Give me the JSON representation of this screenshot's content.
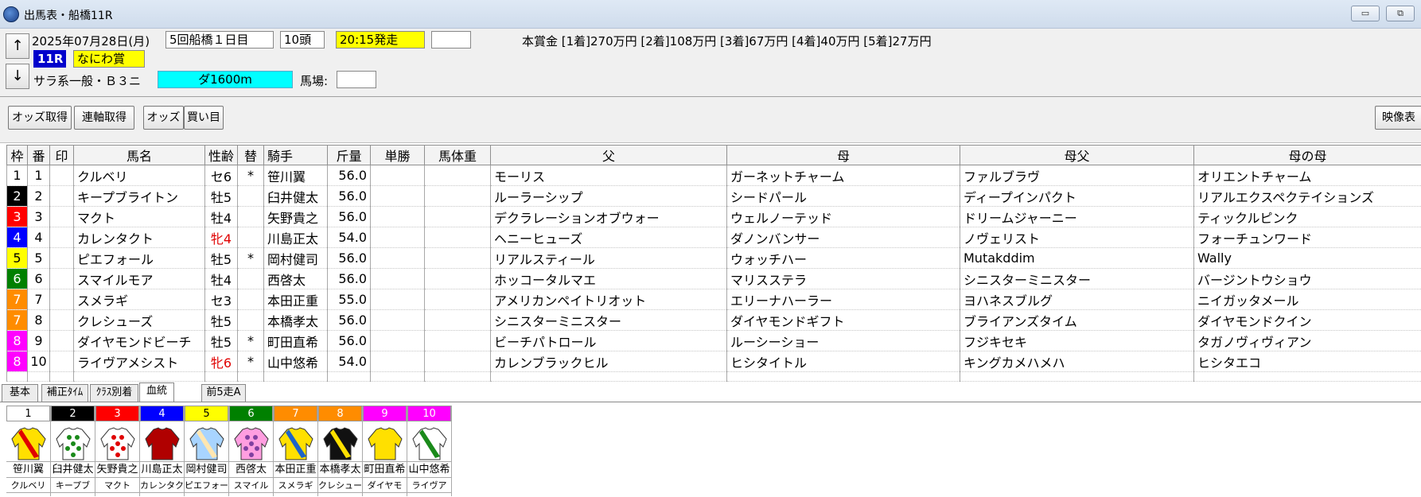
{
  "window": {
    "title": "出馬表・船橋11R",
    "minimize": "▭",
    "restore": "⧉"
  },
  "header": {
    "up_arrow": "↑",
    "down_arrow": "↓",
    "date": "2025年07月28日(月)",
    "meeting": "5回船橋１日目",
    "runners": "10頭",
    "post_time": "20:15発走",
    "blank_box": "",
    "prize": "本賞金 [1着]270万円 [2着]108万円 [3着]67万円 [4着]40万円 [5着]27万円",
    "race_no": "11R",
    "race_name": "なにわ賞",
    "race_class": "サラ系一般・Ｂ３ニ",
    "course": "ダ1600m",
    "going_label": "馬場:",
    "going_value": ""
  },
  "toolbar": {
    "odds": "オッズ取得",
    "renpuku": "連軸取得",
    "odds2": "オッズ",
    "kaime": "買い目",
    "video": "映像表"
  },
  "colors": {
    "waku": [
      "#ffffff",
      "#000000",
      "#ff0000",
      "#0000ff",
      "#ffff00",
      "#008000",
      "#ff8c00",
      "#ff8c00",
      "#ff00ff",
      "#ff00ff"
    ]
  },
  "table": {
    "headers": [
      "枠",
      "番",
      "印",
      "馬名",
      "性齢",
      "替",
      "騎手",
      "斤量",
      "単勝",
      "馬体重",
      "父",
      "母",
      "母父",
      "母の母"
    ],
    "rows": [
      {
        "waku": "1",
        "num": "1",
        "mark": "",
        "name": "クルベリ",
        "sexage": "セ6",
        "change": "*",
        "jockey": "笹川翼",
        "weight": "56.0",
        "win": "",
        "bw": "",
        "sire": "モーリス",
        "dam": "ガーネットチャーム",
        "bms": "ファルブラヴ",
        "damdam": "オリエントチャーム",
        "mare": false
      },
      {
        "waku": "2",
        "num": "2",
        "mark": "",
        "name": "キープブライトン",
        "sexage": "牡5",
        "change": "",
        "jockey": "臼井健太",
        "weight": "56.0",
        "win": "",
        "bw": "",
        "sire": "ルーラーシップ",
        "dam": "シードパール",
        "bms": "ディープインパクト",
        "damdam": "リアルエクスペクテイションズ",
        "mare": false
      },
      {
        "waku": "3",
        "num": "3",
        "mark": "",
        "name": "マクト",
        "sexage": "牡4",
        "change": "",
        "jockey": "矢野貴之",
        "weight": "56.0",
        "win": "",
        "bw": "",
        "sire": "デクラレーションオブウォー",
        "dam": "ウェルノーテッド",
        "bms": "ドリームジャーニー",
        "damdam": "ティックルピンク",
        "mare": false
      },
      {
        "waku": "4",
        "num": "4",
        "mark": "",
        "name": "カレンタクト",
        "sexage": "牝4",
        "change": "",
        "jockey": "川島正太",
        "weight": "54.0",
        "win": "",
        "bw": "",
        "sire": "ヘニーヒューズ",
        "dam": "ダノンバンサー",
        "bms": "ノヴェリスト",
        "damdam": "フォーチュンワード",
        "mare": true
      },
      {
        "waku": "5",
        "num": "5",
        "mark": "",
        "name": "ピエフォール",
        "sexage": "牡5",
        "change": "*",
        "jockey": "岡村健司",
        "weight": "56.0",
        "win": "",
        "bw": "",
        "sire": "リアルスティール",
        "dam": "ウォッチハー",
        "bms": "Mutakddim",
        "damdam": "Wally",
        "mare": false
      },
      {
        "waku": "6",
        "num": "6",
        "mark": "",
        "name": "スマイルモア",
        "sexage": "牡4",
        "change": "",
        "jockey": "西啓太",
        "weight": "56.0",
        "win": "",
        "bw": "",
        "sire": "ホッコータルマエ",
        "dam": "マリスステラ",
        "bms": "シニスターミニスター",
        "damdam": "バージントウショウ",
        "mare": false
      },
      {
        "waku": "7",
        "num": "7",
        "mark": "",
        "name": "スメラギ",
        "sexage": "セ3",
        "change": "",
        "jockey": "本田正重",
        "weight": "55.0",
        "win": "",
        "bw": "",
        "sire": "アメリカンペイトリオット",
        "dam": "エリーナハーラー",
        "bms": "ヨハネスブルグ",
        "damdam": "ニイガッタメール",
        "mare": false
      },
      {
        "waku": "7",
        "num": "8",
        "mark": "",
        "name": "クレシューズ",
        "sexage": "牡5",
        "change": "",
        "jockey": "本橋孝太",
        "weight": "56.0",
        "win": "",
        "bw": "",
        "sire": "シニスターミニスター",
        "dam": "ダイヤモンドギフト",
        "bms": "ブライアンズタイム",
        "damdam": "ダイヤモンドクイン",
        "mare": false
      },
      {
        "waku": "8",
        "num": "9",
        "mark": "",
        "name": "ダイヤモンドビーチ",
        "sexage": "牡5",
        "change": "*",
        "jockey": "町田直希",
        "weight": "56.0",
        "win": "",
        "bw": "",
        "sire": "ビーチパトロール",
        "dam": "ルーシーショー",
        "bms": "フジキセキ",
        "damdam": "タガノヴィヴィアン",
        "mare": false
      },
      {
        "waku": "8",
        "num": "10",
        "mark": "",
        "name": "ライヴアメシスト",
        "sexage": "牝6",
        "change": "*",
        "jockey": "山中悠希",
        "weight": "54.0",
        "win": "",
        "bw": "",
        "sire": "カレンブラックヒル",
        "dam": "ヒシタイトル",
        "bms": "キングカメハメハ",
        "damdam": "ヒシタエコ",
        "mare": true
      }
    ]
  },
  "tabs": [
    "基本",
    "補正ﾀｲﾑ",
    "ｸﾗｽ別着",
    "血統",
    "前5走A"
  ],
  "silks": [
    {
      "num": "1",
      "jockey": "笹川翼",
      "horse": "クルベリ"
    },
    {
      "num": "2",
      "jockey": "臼井健太",
      "horse": "キープブ"
    },
    {
      "num": "3",
      "jockey": "矢野貴之",
      "horse": "マクト"
    },
    {
      "num": "4",
      "jockey": "川島正太",
      "horse": "カレンタク"
    },
    {
      "num": "5",
      "jockey": "岡村健司",
      "horse": "ピエフォー"
    },
    {
      "num": "6",
      "jockey": "西啓太",
      "horse": "スマイル"
    },
    {
      "num": "7",
      "jockey": "本田正重",
      "horse": "スメラギ"
    },
    {
      "num": "8",
      "jockey": "本橋孝太",
      "horse": "クレシュー"
    },
    {
      "num": "9",
      "jockey": "町田直希",
      "horse": "ダイヤモ"
    },
    {
      "num": "10",
      "jockey": "山中悠希",
      "horse": "ライヴア"
    }
  ]
}
